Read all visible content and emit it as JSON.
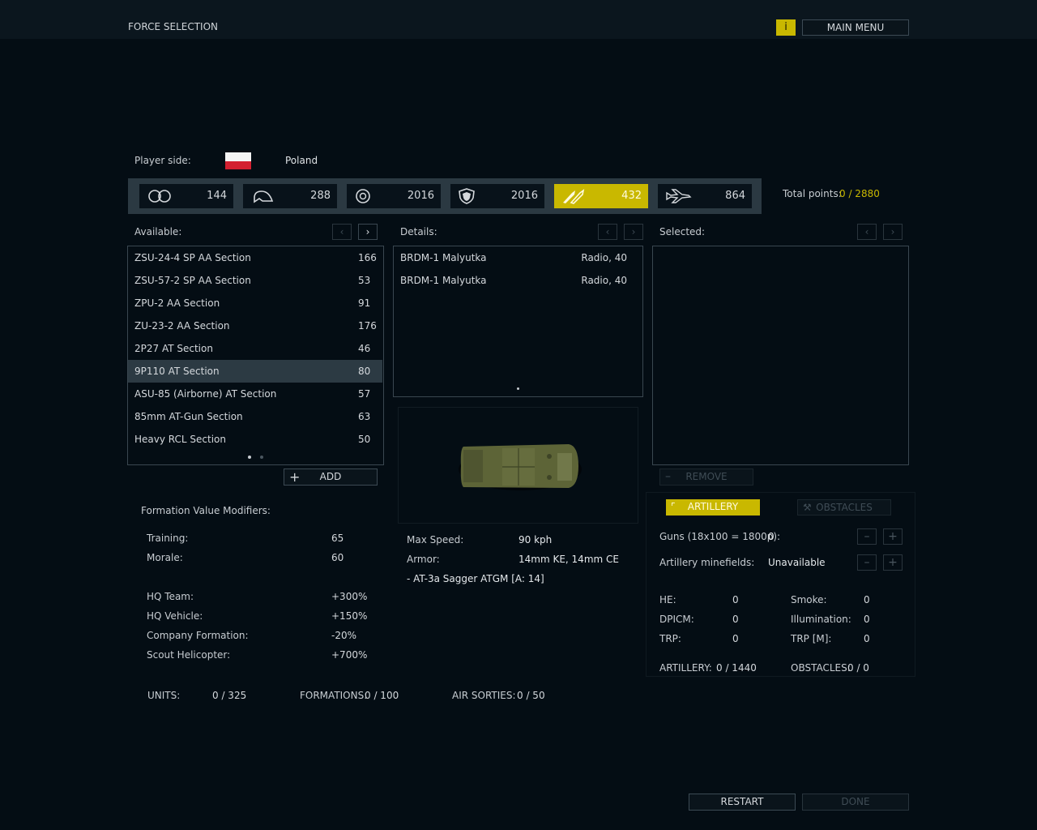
{
  "header": {
    "title": "FORCE SELECTION",
    "info_label": "i",
    "main_menu_label": "MAIN MENU"
  },
  "player": {
    "label": "Player side:",
    "country": "Poland"
  },
  "categories": [
    {
      "icon": "recon-binoculars-icon",
      "value": "144",
      "active": false
    },
    {
      "icon": "infantry-helmet-icon",
      "value": "288",
      "active": false
    },
    {
      "icon": "armor-wheel-icon",
      "value": "2016",
      "active": false
    },
    {
      "icon": "support-shield-icon",
      "value": "2016",
      "active": false
    },
    {
      "icon": "anti-tank-missile-icon",
      "value": "432",
      "active": true
    },
    {
      "icon": "air-jet-icon",
      "value": "864",
      "active": false
    }
  ],
  "total_points": {
    "label": "Total points:",
    "value": "0 / 2880"
  },
  "available": {
    "label": "Available:",
    "items": [
      {
        "name": "ZSU-24-4 SP AA Section",
        "points": "166"
      },
      {
        "name": "ZSU-57-2 SP AA Section",
        "points": "53"
      },
      {
        "name": "ZPU-2 AA Section",
        "points": "91"
      },
      {
        "name": "ZU-23-2 AA Section",
        "points": "176"
      },
      {
        "name": "2P27 AT Section",
        "points": "46"
      },
      {
        "name": "9P110 AT Section",
        "points": "80"
      },
      {
        "name": "ASU-85 (Airborne) AT Section",
        "points": "57"
      },
      {
        "name": "85mm AT-Gun Section",
        "points": "63"
      },
      {
        "name": "Heavy RCL Section",
        "points": "50"
      }
    ],
    "selected_index": 5,
    "add_label": "ADD"
  },
  "details": {
    "label": "Details:",
    "items": [
      {
        "name": "BRDM-1 Malyutka",
        "info": "Radio, 40"
      },
      {
        "name": "BRDM-1 Malyutka",
        "info": "Radio, 40"
      }
    ],
    "stats": [
      {
        "label": "Max Speed:",
        "value": "90 kph"
      },
      {
        "label": "Armor:",
        "value": "14mm KE, 14mm CE"
      }
    ],
    "weapon": "- AT-3a Sagger ATGM [A: 14]"
  },
  "selected": {
    "label": "Selected:",
    "remove_label": "REMOVE"
  },
  "modifiers": {
    "title": "Formation Value Modifiers:",
    "rows": [
      {
        "label": "Training:",
        "value": "65"
      },
      {
        "label": "Morale:",
        "value": "60"
      },
      {
        "label": "HQ Team:",
        "value": "+300%"
      },
      {
        "label": "HQ Vehicle:",
        "value": "+150%"
      },
      {
        "label": "Company Formation:",
        "value": "-20%"
      },
      {
        "label": "Scout Helicopter:",
        "value": "+700%"
      }
    ]
  },
  "totals": [
    {
      "label": "UNITS:",
      "value": "0 / 325"
    },
    {
      "label": "FORMATIONS:",
      "value": "0 / 100"
    },
    {
      "label": "AIR SORTIES:",
      "value": "0 / 50"
    }
  ],
  "support": {
    "tab_artillery": "ARTILLERY",
    "tab_obstacles": "OBSTACLES",
    "guns_label": "Guns (18x100 = 1800p):",
    "guns_value": "0",
    "minefields_label": "Artillery minefields:",
    "minefields_value": "Unavailable",
    "ammo_left": [
      {
        "label": "HE:",
        "value": "0"
      },
      {
        "label": "DPICM:",
        "value": "0"
      },
      {
        "label": "TRP:",
        "value": "0"
      }
    ],
    "ammo_right": [
      {
        "label": "Smoke:",
        "value": "0"
      },
      {
        "label": "Illumination:",
        "value": "0"
      },
      {
        "label": "TRP [M]:",
        "value": "0"
      }
    ],
    "artillery_total_label": "ARTILLERY:",
    "artillery_total_value": "0 / 1440",
    "obstacles_total_label": "OBSTACLES:",
    "obstacles_total_value": "0 / 0"
  },
  "footer": {
    "restart_label": "RESTART",
    "done_label": "DONE"
  },
  "colors": {
    "accent": "#c9b800",
    "background": "#040d14",
    "panel_border": "#3a4750"
  }
}
